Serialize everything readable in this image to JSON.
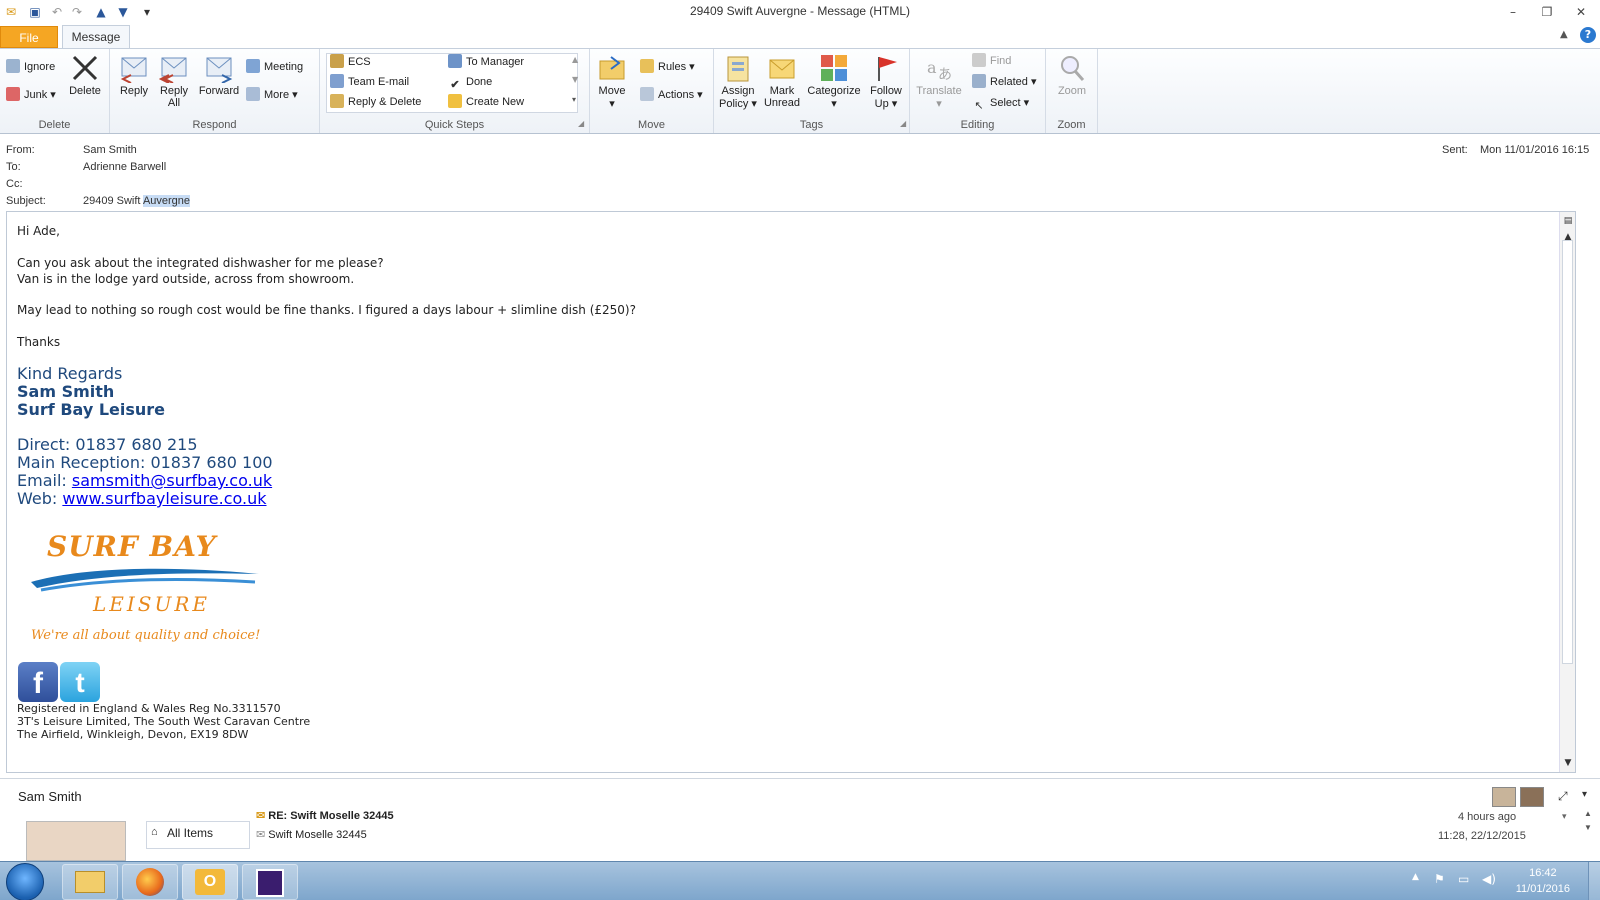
{
  "window": {
    "title": "29409 Swift Auvergne  -  Message (HTML)",
    "minimize": "–",
    "restore": "❐",
    "close": "✕"
  },
  "tabs": {
    "file": "File",
    "message": "Message"
  },
  "ribbon": {
    "delete_group": {
      "label": "Delete",
      "ignore": "Ignore",
      "junk": "Junk",
      "delete": "Delete"
    },
    "respond_group": {
      "label": "Respond",
      "reply": "Reply",
      "reply_all_1": "Reply",
      "reply_all_2": "All",
      "forward": "Forward",
      "meeting": "Meeting",
      "more": "More"
    },
    "quicksteps_group": {
      "label": "Quick Steps",
      "items": [
        "ECS",
        "Team E-mail",
        "Reply & Delete",
        "To Manager",
        "Done",
        "Create New"
      ]
    },
    "move_group": {
      "label": "Move",
      "move": "Move",
      "rules": "Rules",
      "actions": "Actions"
    },
    "tags_group": {
      "label": "Tags",
      "assign_1": "Assign",
      "assign_2": "Policy",
      "mark_1": "Mark",
      "mark_2": "Unread",
      "categorize": "Categorize",
      "follow_1": "Follow",
      "follow_2": "Up"
    },
    "editing_group": {
      "label": "Editing",
      "translate": "Translate",
      "find": "Find",
      "related": "Related",
      "select": "Select"
    },
    "zoom_group": {
      "label": "Zoom",
      "zoom": "Zoom"
    }
  },
  "header": {
    "from_label": "From:",
    "from_value": "Sam Smith",
    "to_label": "To:",
    "to_value": "Adrienne Barwell",
    "cc_label": "Cc:",
    "subject_label": "Subject:",
    "subject_prefix": "29409 Swift ",
    "subject_highlight": "Auvergne",
    "sent_label": "Sent:",
    "sent_value": "Mon 11/01/2016 16:15"
  },
  "body": {
    "greeting": "Hi Ade,",
    "line1": "Can you ask about the integrated dishwasher for me please?",
    "line2": "Van is in the lodge yard outside, across from showroom.",
    "line3": "May lead to nothing so rough cost would be fine thanks. I figured a days labour + slimline dish (£250)?",
    "thanks": "Thanks",
    "regards": "Kind Regards",
    "sig_name": "Sam Smith",
    "sig_company": "Surf Bay Leisure",
    "direct_label": "Direct:  01837 680 215",
    "reception_label": "Main Reception:  01837 680 100",
    "email_label": "Email: ",
    "email_value": "samsmith@surfbay.co.uk",
    "web_label": "Web: ",
    "web_value": "www.surfbayleisure.co.uk",
    "logo_line1": "SURF BAY",
    "logo_line2": "LEISURE",
    "logo_tagline": "We're all about quality and choice!",
    "footer1": "Registered in England & Wales Reg No.3311570",
    "footer2": "3T's Leisure Limited, The South West Caravan Centre",
    "footer3": "The Airfield, Winkleigh, Devon, EX19 8DW"
  },
  "people_pane": {
    "name": "Sam Smith",
    "all_items": "All Items",
    "mail1_subject": "RE: Swift Moselle 32445",
    "mail1_time": "4 hours ago",
    "mail2_subject": "Swift Moselle 32445",
    "mail2_time": "11:28, 22/12/2015"
  },
  "taskbar": {
    "time": "16:42",
    "date": "11/01/2016"
  },
  "colors": {
    "file_tab": "#f5a623",
    "signature_blue": "#1f497d",
    "link": "#0000ee",
    "logo_orange": "#e8891c",
    "logo_blue": "#1b6fb5"
  }
}
